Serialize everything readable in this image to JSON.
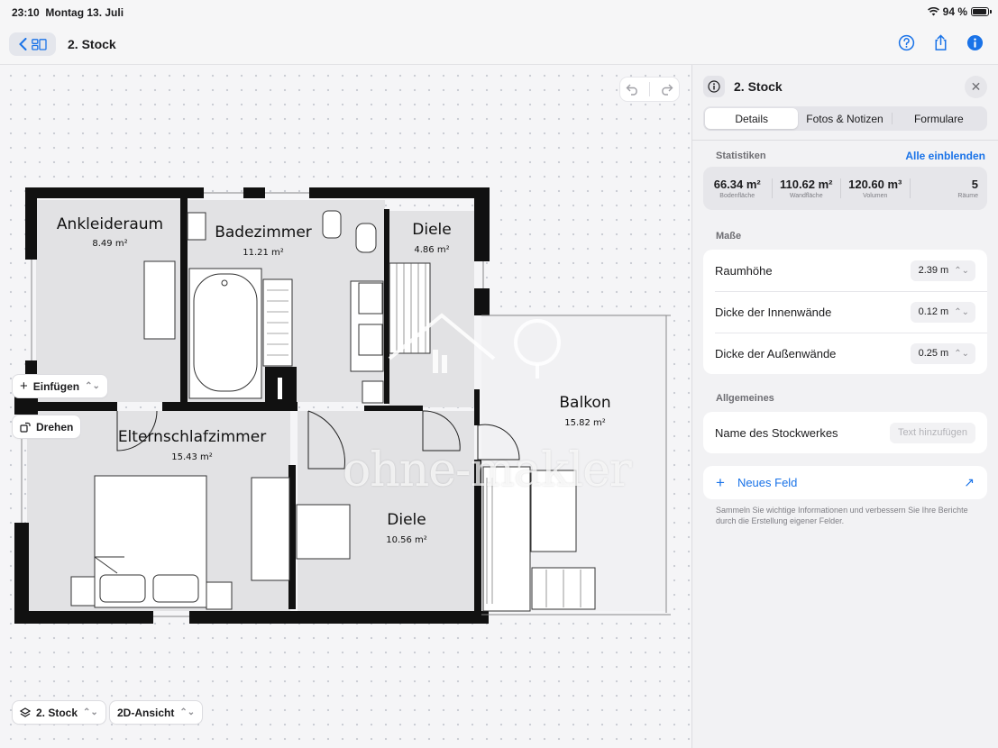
{
  "status_bar": {
    "time": "23:10",
    "date": "Montag 13. Juli",
    "battery": "94 %",
    "battery_level": 0.94
  },
  "nav": {
    "title": "2. Stock",
    "icons": [
      "chevron-left-icon",
      "sidebar-icon",
      "help-icon",
      "share-icon",
      "info-icon"
    ]
  },
  "floorplan": {
    "rooms": [
      {
        "name": "Ankleideraum",
        "area": "8.49 m²"
      },
      {
        "name": "Badezimmer",
        "area": "11.21 m²"
      },
      {
        "name": "Diele",
        "area": "4.86 m²"
      },
      {
        "name": "Elternschlafzimmer",
        "area": "15.43 m²"
      },
      {
        "name": "Diele",
        "area": "10.56 m²"
      },
      {
        "name": "Balkon",
        "area": "15.82 m²"
      }
    ],
    "watermark": "ohne-makler"
  },
  "canvas_tools": {
    "insert_label": "Einfügen",
    "rotate_label": "Drehen",
    "floor_select": "2. Stock",
    "view_select": "2D-Ansicht"
  },
  "panel": {
    "title": "2. Stock",
    "tabs": [
      "Details",
      "Fotos & Notizen",
      "Formulare"
    ],
    "active_tab": "Details",
    "statistics": {
      "label": "Statistiken",
      "show_all": "Alle einblenden",
      "items": [
        {
          "value": "66.34 m²",
          "label": "Bodenfläche"
        },
        {
          "value": "110.62 m²",
          "label": "Wandfläche"
        },
        {
          "value": "120.60 m³",
          "label": "Volumen"
        },
        {
          "value": "5",
          "label": "Räume"
        }
      ]
    },
    "measures": {
      "label": "Maße",
      "rows": [
        {
          "label": "Raumhöhe",
          "value": "2.39 m"
        },
        {
          "label": "Dicke der Innenwände",
          "value": "0.12 m"
        },
        {
          "label": "Dicke der Außenwände",
          "value": "0.25 m"
        }
      ]
    },
    "general": {
      "label": "Allgemeines",
      "rows": [
        {
          "label": "Name des Stockwerkes",
          "placeholder": "Text hinzufügen"
        }
      ]
    },
    "new_field": "Neues Feld",
    "hint": "Sammeln Sie wichtige Informationen und verbessern Sie Ihre Berichte durch die Erstellung eigener Felder."
  },
  "colors": {
    "accent": "#1a73e8",
    "wall": "#111111",
    "room_fill": "#e2e2e4"
  }
}
